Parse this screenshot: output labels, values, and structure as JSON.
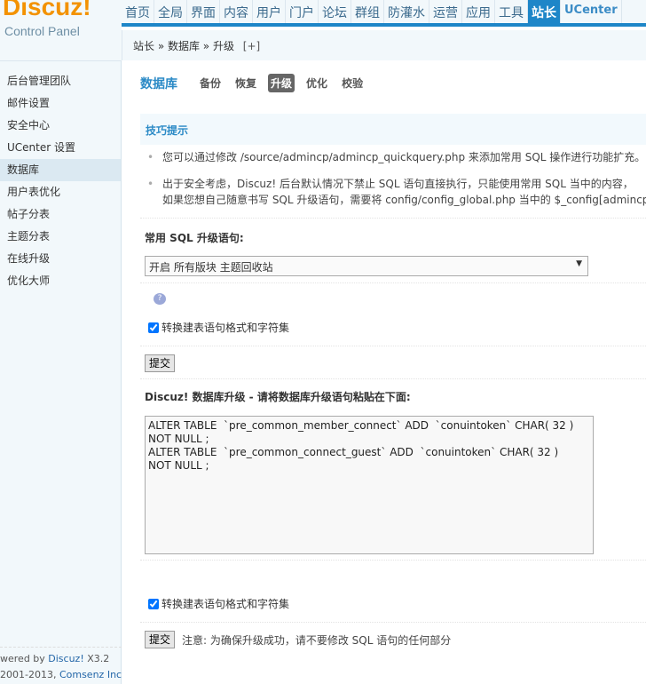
{
  "logo": {
    "brand": "Discuz!",
    "subtitle": "Control Panel"
  },
  "nav": [
    "首页",
    "全局",
    "界面",
    "内容",
    "用户",
    "门户",
    "论坛",
    "群组",
    "防灌水",
    "运营",
    "应用",
    "工具",
    "站长",
    "UCenter"
  ],
  "nav_active": "站长",
  "breadcrumb": {
    "text": "站长 » 数据库 » 升级",
    "plus": "[+]"
  },
  "sidebar": {
    "items": [
      "后台管理团队",
      "邮件设置",
      "安全中心",
      "UCenter 设置",
      "数据库",
      "用户表优化",
      "帖子分表",
      "主题分表",
      "在线升级",
      "优化大师"
    ],
    "active": "数据库"
  },
  "footer": {
    "powered": "wered by ",
    "discuz": "Discuz!",
    "version": " X3.2",
    "copy": "2001-2013, ",
    "company": "Comsenz Inc."
  },
  "tabs": {
    "title": "数据库",
    "items": [
      "备份",
      "恢复",
      "升级",
      "优化",
      "校验"
    ],
    "active": "升级"
  },
  "tips": {
    "title": "技巧提示",
    "b1": "您可以通过修改 /source/admincp/admincp_quickquery.php 来添加常用 SQL 操作进行功能扩充。",
    "b2a": "出于安全考虑，Discuz! 后台默认情况下禁止 SQL 语句直接执行，只能使用常用 SQL 当中的内容，",
    "b2b": "如果您想自己随意书写 SQL 升级语句，需要将 config/config_global.php 当中的 $_config[admincp"
  },
  "form1": {
    "label": "常用 SQL 升级语句:",
    "selected": "开启 所有版块 主题回收站",
    "checkbox": "转换建表语句格式和字符集",
    "submit": "提交"
  },
  "form2": {
    "label": "Discuz! 数据库升级 - 请将数据库升级语句粘贴在下面:",
    "sql": "ALTER TABLE  `pre_common_member_connect` ADD  `conuintoken` CHAR( 32 )\nNOT NULL ;\nALTER TABLE  `pre_common_connect_guest` ADD  `conuintoken` CHAR( 32 )\nNOT NULL ;",
    "checkbox": "转换建表语句格式和字符集",
    "submit": "提交",
    "note": "注意: 为确保升级成功，请不要修改 SQL 语句的任何部分"
  }
}
